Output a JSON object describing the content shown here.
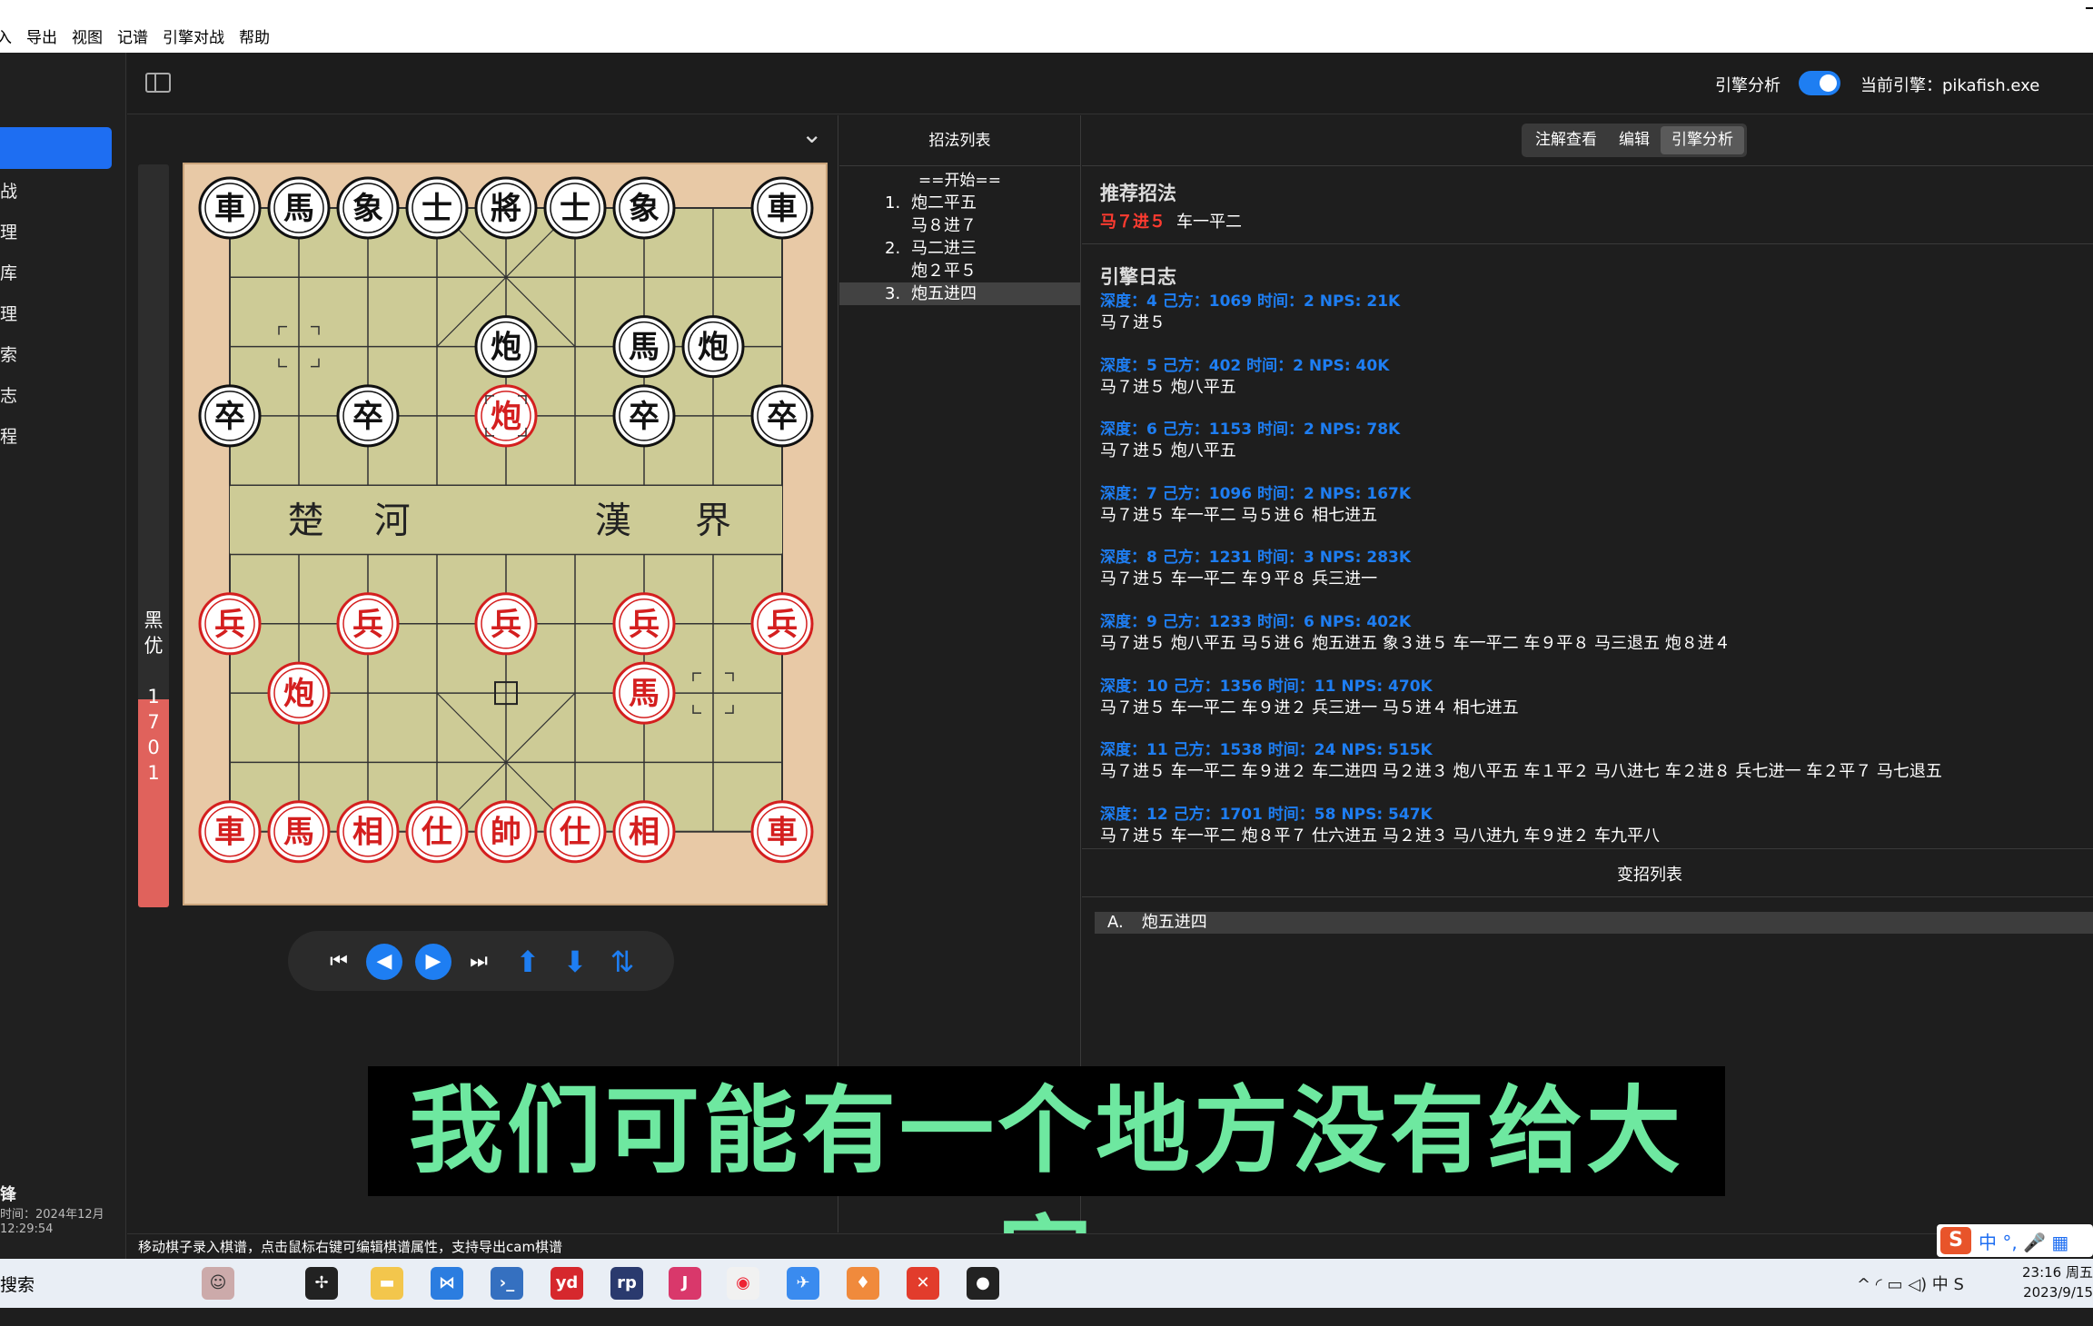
{
  "menu": [
    "入",
    "导出",
    "视图",
    "记谱",
    "引擎对战",
    "帮助"
  ],
  "sidebar": {
    "items": [
      "",
      "战",
      "理",
      "库",
      "理",
      "索",
      "志",
      "程"
    ],
    "user": "锋",
    "meta1": "时间：2024年12月",
    "meta2": "12:29:54"
  },
  "topbar": {
    "engine_analysis": "引擎分析",
    "current_engine": "当前引擎：pikafish.exe",
    "toggle_on": true
  },
  "eval": {
    "text": "黑\n优\n\n1\n7\n0\n1",
    "fill_fraction": 0.28
  },
  "board": {
    "river_left": [
      "楚",
      "河"
    ],
    "river_right": [
      "漢",
      "界"
    ],
    "pieces": [
      {
        "c": "車",
        "s": "b",
        "f": 0,
        "r": 0
      },
      {
        "c": "馬",
        "s": "b",
        "f": 1,
        "r": 0
      },
      {
        "c": "象",
        "s": "b",
        "f": 2,
        "r": 0
      },
      {
        "c": "士",
        "s": "b",
        "f": 3,
        "r": 0
      },
      {
        "c": "將",
        "s": "b",
        "f": 4,
        "r": 0
      },
      {
        "c": "士",
        "s": "b",
        "f": 5,
        "r": 0
      },
      {
        "c": "象",
        "s": "b",
        "f": 6,
        "r": 0
      },
      {
        "c": "車",
        "s": "b",
        "f": 8,
        "r": 0
      },
      {
        "c": "炮",
        "s": "b",
        "f": 4,
        "r": 2
      },
      {
        "c": "馬",
        "s": "b",
        "f": 6,
        "r": 2
      },
      {
        "c": "炮",
        "s": "b",
        "f": 7,
        "r": 2
      },
      {
        "c": "卒",
        "s": "b",
        "f": 0,
        "r": 3
      },
      {
        "c": "卒",
        "s": "b",
        "f": 2,
        "r": 3
      },
      {
        "c": "炮",
        "s": "r",
        "f": 4,
        "r": 3
      },
      {
        "c": "卒",
        "s": "b",
        "f": 6,
        "r": 3
      },
      {
        "c": "卒",
        "s": "b",
        "f": 8,
        "r": 3
      },
      {
        "c": "兵",
        "s": "r",
        "f": 0,
        "r": 6
      },
      {
        "c": "兵",
        "s": "r",
        "f": 2,
        "r": 6
      },
      {
        "c": "兵",
        "s": "r",
        "f": 4,
        "r": 6
      },
      {
        "c": "兵",
        "s": "r",
        "f": 6,
        "r": 6
      },
      {
        "c": "兵",
        "s": "r",
        "f": 8,
        "r": 6
      },
      {
        "c": "炮",
        "s": "r",
        "f": 1,
        "r": 7
      },
      {
        "c": "馬",
        "s": "r",
        "f": 6,
        "r": 7
      },
      {
        "c": "車",
        "s": "r",
        "f": 0,
        "r": 9
      },
      {
        "c": "馬",
        "s": "r",
        "f": 1,
        "r": 9
      },
      {
        "c": "相",
        "s": "r",
        "f": 2,
        "r": 9
      },
      {
        "c": "仕",
        "s": "r",
        "f": 3,
        "r": 9
      },
      {
        "c": "帥",
        "s": "r",
        "f": 4,
        "r": 9
      },
      {
        "c": "仕",
        "s": "r",
        "f": 5,
        "r": 9
      },
      {
        "c": "相",
        "s": "r",
        "f": 6,
        "r": 9
      },
      {
        "c": "車",
        "s": "r",
        "f": 8,
        "r": 9
      }
    ]
  },
  "movelist": {
    "title": "招法列表",
    "start": "==开始==",
    "rows": [
      {
        "num": "1.",
        "text": "炮二平五",
        "sel": false
      },
      {
        "num": "",
        "text": "马８进７",
        "sel": false
      },
      {
        "num": "2.",
        "text": "马二进三",
        "sel": false
      },
      {
        "num": "",
        "text": "炮２平５",
        "sel": false
      },
      {
        "num": "3.",
        "text": "炮五进四",
        "sel": true
      }
    ]
  },
  "analysis": {
    "tabs": [
      "注解查看",
      "编辑",
      "引擎分析"
    ],
    "active_tab": 2,
    "rec_title": "推荐招法",
    "rec_best": "马７进５",
    "rec_next": "车一平二",
    "log_title": "引擎日志",
    "log": [
      {
        "head": "深度：4 己方：1069 时间：2 NPS: 21K",
        "pv": "马７进５"
      },
      {
        "head": "深度：5 己方：402 时间：2 NPS: 40K",
        "pv": "马７进５ 炮八平五"
      },
      {
        "head": "深度：6 己方：1153 时间：2 NPS: 78K",
        "pv": "马７进５ 炮八平五"
      },
      {
        "head": "深度：7 己方：1096 时间：2 NPS: 167K",
        "pv": "马７进５ 车一平二 马５进６ 相七进五"
      },
      {
        "head": "深度：8 己方：1231 时间：3 NPS: 283K",
        "pv": "马７进５ 车一平二 车９平８ 兵三进一"
      },
      {
        "head": "深度：9 己方：1233 时间：6 NPS: 402K",
        "pv": "马７进５ 炮八平五 马５进６ 炮五进五 象３进５ 车一平二 车９平８ 马三退五 炮８进４"
      },
      {
        "head": "深度：10 己方：1356 时间：11 NPS: 470K",
        "pv": "马７进５ 车一平二 车９进２ 兵三进一 马５进４ 相七进五"
      },
      {
        "head": "深度：11 己方：1538 时间：24 NPS: 515K",
        "pv": "马７进５ 车一平二 车９进２ 车二进四 马２进３ 炮八平五 车１平２ 马八进七 车２进８ 兵七进一 车２平７ 马七退五"
      },
      {
        "head": "深度：12 己方：1701 时间：58 NPS: 547K",
        "pv": "马７进５ 车一平二 炮８平７ 仕六进五 马２进３ 马八进九 车９进２ 车九平八"
      }
    ],
    "var_title": "变招列表",
    "var_label": "A.",
    "var_move": "炮五进四"
  },
  "subtitle": "我们可能有一个地方没有给大家",
  "status": "移动棋子录入棋谱，点击鼠标右键可编辑棋谱属性，支持导出cam棋谱",
  "ime": {
    "logo": "S",
    "text": "中 °, 🎤 ▦"
  },
  "taskbar": {
    "search": "搜索",
    "tray": "^  ◜  ▭  ◁)  中  S",
    "time": "23:16 周五",
    "date": "2023/9/15"
  },
  "colors": {
    "accent": "#1e7ef2",
    "eval_red": "#e0625c",
    "best_move": "#ff3b30",
    "subtitle": "#6ee8a0"
  }
}
